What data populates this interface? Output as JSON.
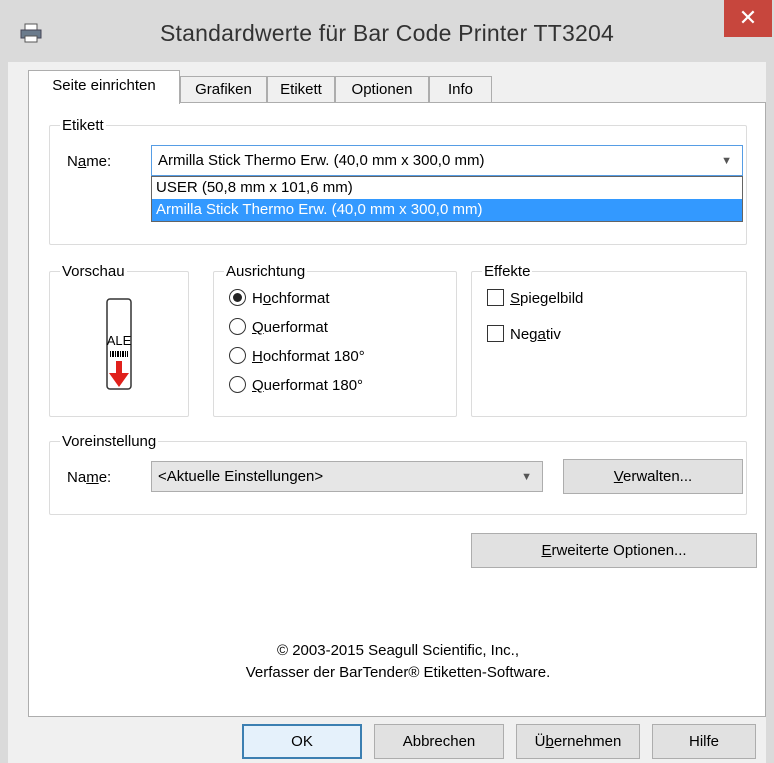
{
  "window": {
    "title": "Standardwerte für Bar Code Printer TT3204",
    "close_glyph": "✕"
  },
  "tabs": [
    {
      "label": "Seite einrichten",
      "active": true
    },
    {
      "label": "Grafiken"
    },
    {
      "label": "Etikett"
    },
    {
      "label": "Optionen"
    },
    {
      "label": "Info"
    }
  ],
  "etikett": {
    "legend": "Etikett",
    "name_label_pre": "N",
    "name_label_u": "a",
    "name_label_post": "me:",
    "selected": "Armilla Stick Thermo Erw. (40,0 mm x 300,0 mm)",
    "options": [
      "USER (50,8 mm x 101,6 mm)",
      "Armilla Stick Thermo Erw. (40,0 mm x 300,0 mm)"
    ]
  },
  "vorschau": {
    "legend": "Vorschau",
    "preview_text": "ALE"
  },
  "ausrichtung": {
    "legend": "Ausrichtung",
    "options": [
      {
        "pre": "H",
        "u": "o",
        "post": "chformat",
        "checked": true
      },
      {
        "pre": "",
        "u": "Q",
        "post": "uerformat",
        "checked": false
      },
      {
        "pre": "",
        "u": "H",
        "post": "ochformat 180°",
        "checked": false
      },
      {
        "pre": "",
        "u": "Q",
        "post": "uerformat 180°",
        "checked": false
      }
    ]
  },
  "effekte": {
    "legend": "Effekte",
    "options": [
      {
        "pre": "",
        "u": "S",
        "post": "piegelbild"
      },
      {
        "pre": "Neg",
        "u": "a",
        "post": "tiv"
      }
    ]
  },
  "voreinstellung": {
    "legend": "Voreinstellung",
    "name_label_pre": "Na",
    "name_label_u": "m",
    "name_label_post": "e:",
    "selected": "<Aktuelle Einstellungen>",
    "manage_pre": "",
    "manage_u": "V",
    "manage_post": "erwalten..."
  },
  "advanced_pre": "",
  "advanced_u": "E",
  "advanced_post": "rweiterte Optionen...",
  "copyright": {
    "line1": "© 2003-2015 Seagull Scientific, Inc.,",
    "line2": "Verfasser der BarTender® Etiketten-Software."
  },
  "buttons": {
    "ok": "OK",
    "cancel": "Abbrechen",
    "apply_pre": "Ü",
    "apply_u": "b",
    "apply_post": "ernehmen",
    "help": "Hilfe"
  },
  "colors": {
    "close": "#c7463d",
    "selection": "#3399ff",
    "arrow_red": "#e0201b"
  }
}
